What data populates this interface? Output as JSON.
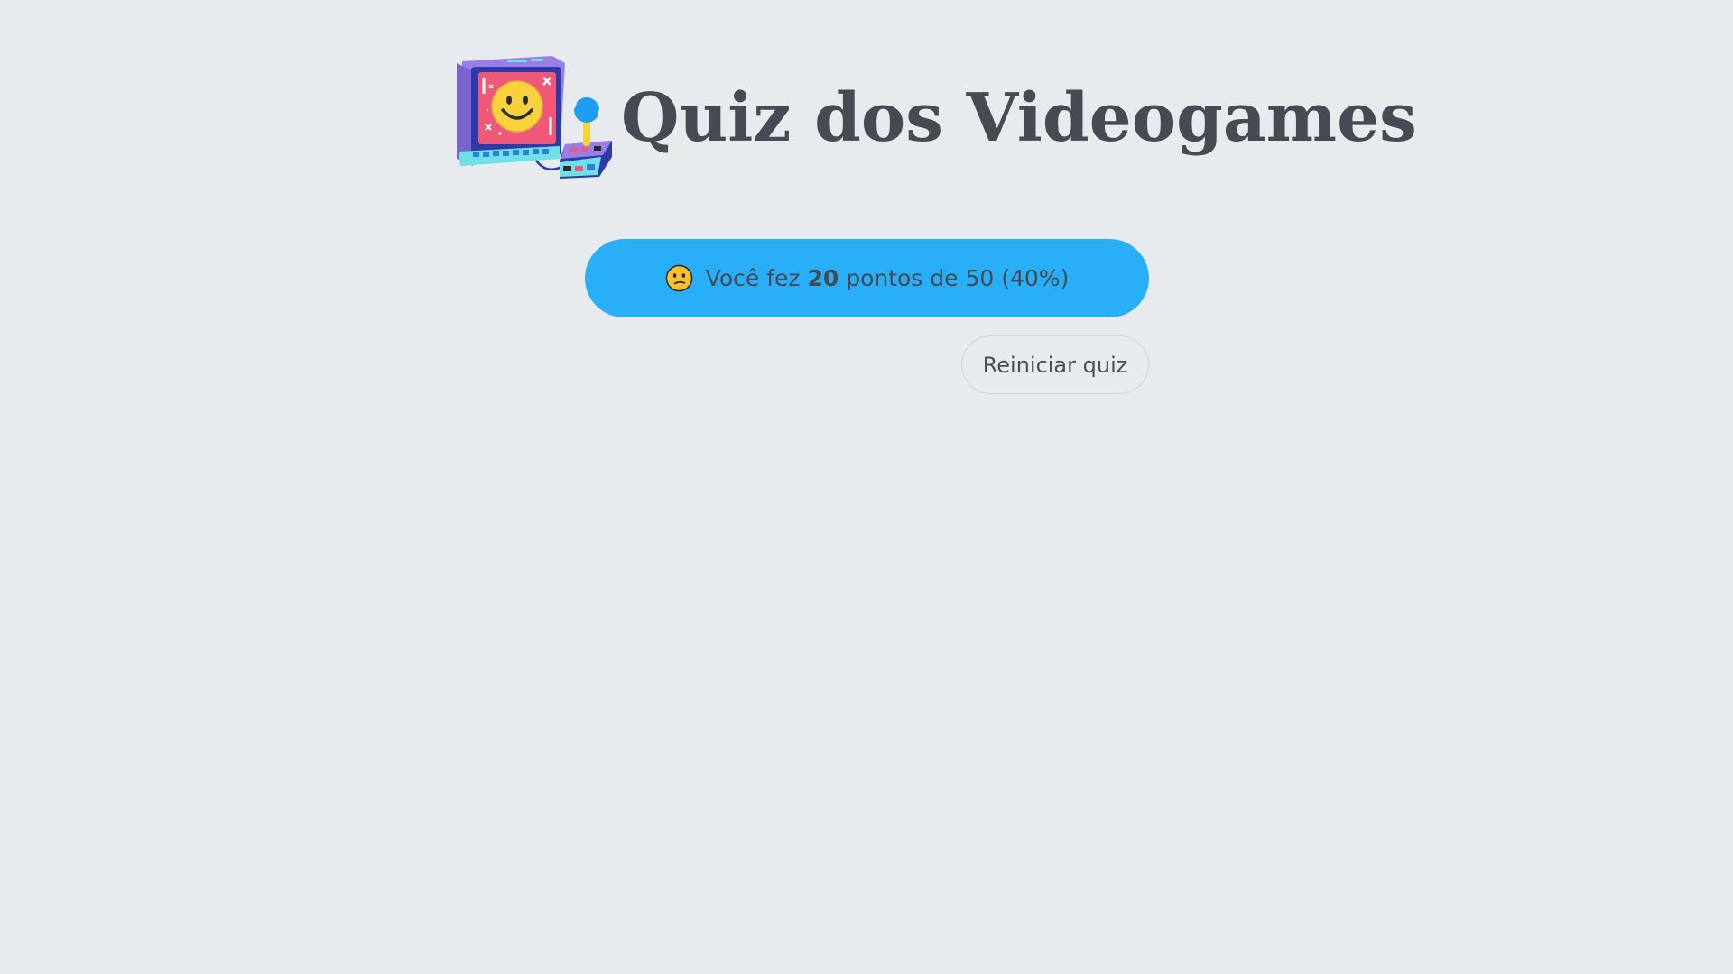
{
  "header": {
    "logo_icon": "retro-tv-joystick-icon",
    "title": "Quiz dos Videogames"
  },
  "result": {
    "emoji_icon": "confused-face-icon",
    "prefix": "Você fez ",
    "score": "20",
    "middle": " pontos de ",
    "total": "50",
    "percent": " (40%)",
    "score_value": 20,
    "total_value": 50,
    "percent_value": 40
  },
  "actions": {
    "restart_label": "Reiniciar quiz"
  },
  "colors": {
    "background": "#e8ebee",
    "banner": "#29aef8",
    "title_text": "#464a52",
    "body_text": "#454b55"
  }
}
